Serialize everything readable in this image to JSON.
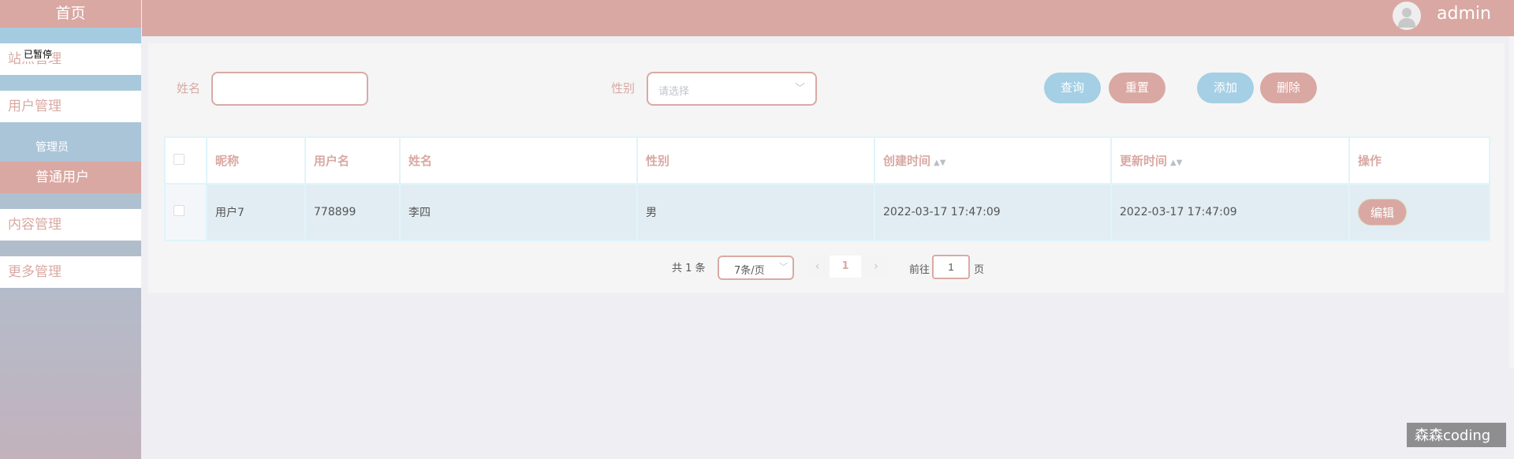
{
  "sidebar": {
    "home": "首页",
    "paused_overlay": "已暂停",
    "items": [
      "站点管理",
      "用户管理",
      "内容管理",
      "更多管理"
    ],
    "sub_items": [
      "管理员",
      "普通用户"
    ]
  },
  "header": {
    "username": "admin",
    "avatar_icon": "user-avatar-icon"
  },
  "filters": {
    "name_label": "姓名",
    "name_value": "",
    "gender_label": "性别",
    "gender_placeholder": "请选择"
  },
  "buttons": {
    "search": "查询",
    "reset": "重置",
    "add": "添加",
    "delete": "删除"
  },
  "table": {
    "headers": [
      "昵称",
      "用户名",
      "姓名",
      "性别",
      "创建时间",
      "更新时间",
      "操作"
    ],
    "rows": [
      {
        "nickname": "用户7",
        "username": "778899",
        "name": "李四",
        "gender": "男",
        "created": "2022-03-17 17:47:09",
        "updated": "2022-03-17 17:47:09",
        "action": "编辑"
      }
    ]
  },
  "pagination": {
    "total": "共 1 条",
    "page_size": "7条/页",
    "current_page": "1",
    "goto_label": "前往",
    "goto_value": "1",
    "page_suffix": "页"
  },
  "watermark": "森森coding",
  "colors": {
    "pink": "#d9a8a3",
    "blue": "#a4cfe4",
    "row_bg": "#e1edf2"
  }
}
